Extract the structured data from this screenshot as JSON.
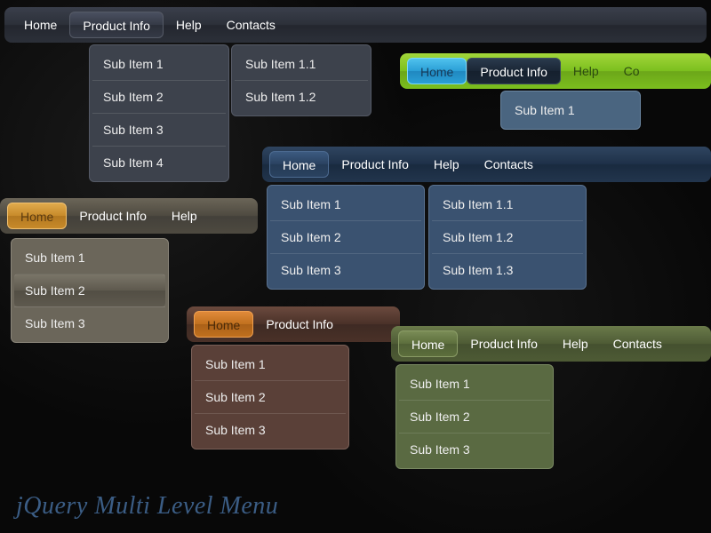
{
  "title": "jQuery Multi Level Menu",
  "menus": {
    "dark": {
      "items": [
        "Home",
        "Product Info",
        "Help",
        "Contacts"
      ]
    },
    "green": {
      "items": [
        "Home",
        "Product Info",
        "Help",
        "Co"
      ]
    },
    "blue": {
      "items": [
        "Home",
        "Product Info",
        "Help",
        "Contacts"
      ]
    },
    "tan": {
      "items": [
        "Home",
        "Product Info",
        "Help"
      ]
    },
    "brown": {
      "items": [
        "Home",
        "Product Info"
      ]
    },
    "olive": {
      "items": [
        "Home",
        "Product Info",
        "Help",
        "Contacts"
      ]
    }
  },
  "subs": {
    "dark_l1": [
      "Sub Item 1",
      "Sub Item 2",
      "Sub Item 3",
      "Sub Item 4"
    ],
    "dark_l2": [
      "Sub Item 1.1",
      "Sub Item 1.2"
    ],
    "green_l1": [
      "Sub Item 1"
    ],
    "blue_l1": [
      "Sub Item 1",
      "Sub Item 2",
      "Sub Item 3"
    ],
    "blue_l2": [
      "Sub Item 1.1",
      "Sub Item 1.2",
      "Sub Item 1.3"
    ],
    "tan_l1": [
      "Sub Item 1",
      "Sub Item 2",
      "Sub Item 3"
    ],
    "brown_l1": [
      "Sub Item 1",
      "Sub Item 2",
      "Sub Item 3"
    ],
    "olive_l1": [
      "Sub Item 1",
      "Sub Item 2",
      "Sub Item 3"
    ]
  }
}
